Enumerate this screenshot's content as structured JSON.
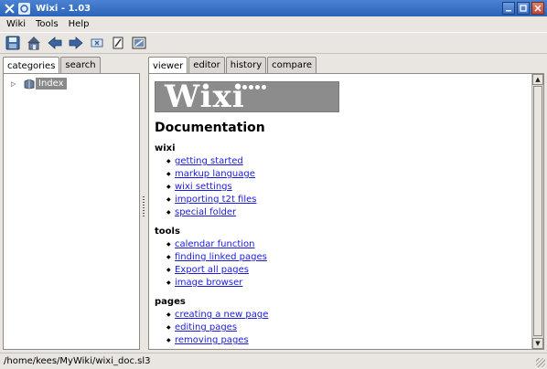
{
  "window": {
    "title": "Wixi - 1.03",
    "buttons": [
      "minimize",
      "maximize",
      "close"
    ]
  },
  "menubar": {
    "items": [
      {
        "label": "Wiki",
        "mnemonic": "W"
      },
      {
        "label": "Tools",
        "mnemonic": "T"
      },
      {
        "label": "Help",
        "mnemonic": "H"
      }
    ]
  },
  "toolbar": {
    "icons": [
      "save-icon",
      "home-icon",
      "back-icon",
      "forward-icon",
      "stop-icon",
      "edit-icon",
      "settings-icon"
    ]
  },
  "left_panel": {
    "tabs": [
      "categories",
      "search"
    ],
    "active_tab": "categories",
    "tree": [
      {
        "label": "Index",
        "expander": "▷",
        "selected": true
      }
    ]
  },
  "right_panel": {
    "tabs": [
      "viewer",
      "editor",
      "history",
      "compare"
    ],
    "active_tab": "viewer",
    "logo_text": "Wixi",
    "doc_title": "Documentation",
    "sections": [
      {
        "title": "wixi",
        "links": [
          "getting started",
          "markup language",
          "wixi settings",
          "importing t2t files",
          "special folder"
        ]
      },
      {
        "title": "tools",
        "links": [
          "calendar function",
          "finding linked pages",
          "Export all pages",
          "image browser"
        ]
      },
      {
        "title": "pages",
        "links": [
          "creating a new page",
          "editing pages",
          "removing pages"
        ]
      }
    ]
  },
  "statusbar": {
    "text": "/home/kees/MyWiki/wixi_doc.sl3"
  },
  "colors": {
    "titlebar": "#2d63b6",
    "link": "#1a1ae0",
    "selection": "#8a8a8a"
  }
}
